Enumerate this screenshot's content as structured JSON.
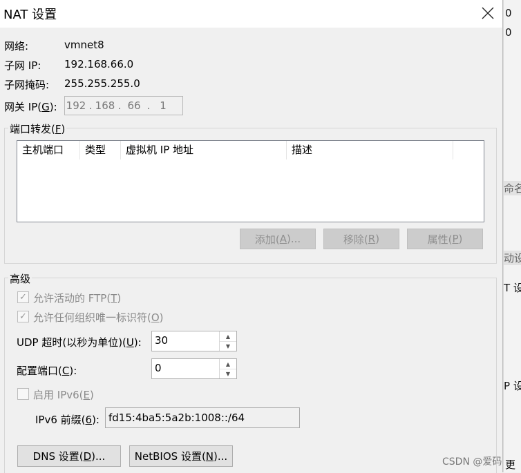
{
  "window": {
    "title": "NAT 设置",
    "close_glyph": "✕"
  },
  "info": {
    "network_label": "网络:",
    "network_value": "vmnet8",
    "subnet_ip_label": "子网 IP:",
    "subnet_ip_value": "192.168.66.0",
    "subnet_mask_label": "子网掩码:",
    "subnet_mask_value": "255.255.255.0",
    "gateway_label_pre": "网关 IP(",
    "gateway_label_key": "G",
    "gateway_label_post": "):",
    "gateway_octets": [
      "192",
      "168",
      "66",
      "1"
    ],
    "gateway_dot": "."
  },
  "port_forwarding": {
    "legend_pre": "端口转发(",
    "legend_key": "F",
    "legend_post": ")",
    "columns": [
      "主机端口",
      "类型",
      "虚拟机 IP 地址",
      "描述"
    ],
    "rows": [],
    "add": {
      "pre": "添加(",
      "key": "A",
      "post": ")..."
    },
    "remove": {
      "pre": "移除(",
      "key": "R",
      "post": ")"
    },
    "properties": {
      "pre": "属性(",
      "key": "P",
      "post": ")"
    }
  },
  "advanced": {
    "legend": "高级",
    "allow_ftp": {
      "pre": "允许活动的 FTP(",
      "key": "T",
      "post": ")",
      "checked": true
    },
    "allow_oui": {
      "pre": "允许任何组织唯一标识符(",
      "key": "O",
      "post": ")",
      "checked": true
    },
    "udp_timeout": {
      "pre": "UDP 超时(以秒为单位)(",
      "key": "U",
      "post": "):",
      "value": "30"
    },
    "config_port": {
      "pre": "配置端口(",
      "key": "C",
      "post": "):",
      "value": "0"
    },
    "enable_ipv6": {
      "pre": "启用 IPv6(",
      "key": "E",
      "post": ")",
      "checked": false
    },
    "ipv6_prefix": {
      "pre": "IPv6 前缀(",
      "key": "6",
      "post": "):",
      "value": "fd15:4ba5:5a2b:1008::/64"
    },
    "check_glyph": "✓",
    "spin_up_glyph": "▲",
    "spin_down_glyph": "▼"
  },
  "buttons": {
    "dns": {
      "pre": "DNS 设置(",
      "key": "D",
      "post": ")..."
    },
    "netbios": {
      "pre": "NetBIOS 设置(",
      "key": "N",
      "post": ")..."
    }
  },
  "background_fragments": [
    "0",
    "0",
    "命名",
    "动设",
    "T 设",
    "P 设",
    "更"
  ],
  "watermark": "CSDN @爱码"
}
